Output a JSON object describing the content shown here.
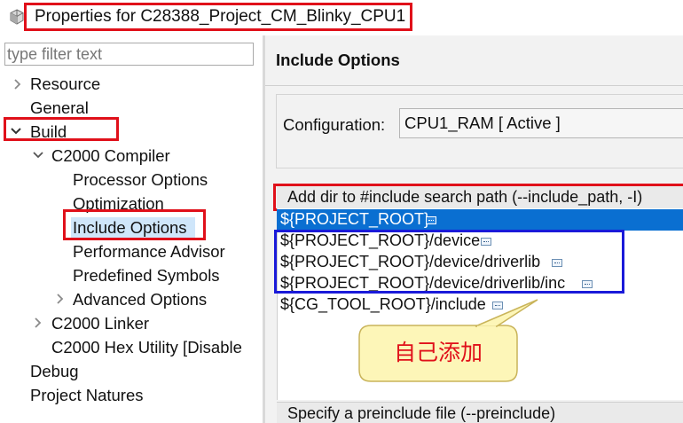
{
  "window": {
    "title": "Properties for C28388_Project_CM_Blinky_CPU1",
    "icon": "properties-icon"
  },
  "left_panel": {
    "filter_placeholder": "type filter text",
    "tree": [
      {
        "label": "Resource",
        "expanded": false
      },
      {
        "label": "General"
      },
      {
        "label": "Build",
        "expanded": true
      },
      {
        "label": "C2000 Compiler",
        "expanded": true
      },
      {
        "label": "Processor Options"
      },
      {
        "label": "Optimization"
      },
      {
        "label": "Include Options",
        "selected": true
      },
      {
        "label": "Performance Advisor"
      },
      {
        "label": "Predefined Symbols"
      },
      {
        "label": "Advanced Options",
        "expanded": false
      },
      {
        "label": "C2000 Linker",
        "expanded": false
      },
      {
        "label": "C2000 Hex Utility  [Disable"
      },
      {
        "label": "Debug"
      },
      {
        "label": "Project Natures"
      }
    ]
  },
  "right_panel": {
    "heading": "Include Options",
    "configuration_label": "Configuration:",
    "configuration_value": "CPU1_RAM  [ Active ]",
    "include_group_title": "Add dir to #include search path (--include_path, -I)",
    "include_paths": [
      "${PROJECT_ROOT}",
      "${PROJECT_ROOT}/device",
      "${PROJECT_ROOT}/device/driverlib",
      "${PROJECT_ROOT}/device/driverlib/inc",
      "${CG_TOOL_ROOT}/include"
    ],
    "selected_path_index": 0,
    "preinclude_title": "Specify a preinclude file (--preinclude)"
  },
  "annotation": {
    "callout_text": "自己添加"
  },
  "colors": {
    "annotation_red": "#e0101a",
    "annotation_blue": "#1a1ad9",
    "selection_blue": "#0a6fd1",
    "callout_fill": "#fdf6b8"
  }
}
